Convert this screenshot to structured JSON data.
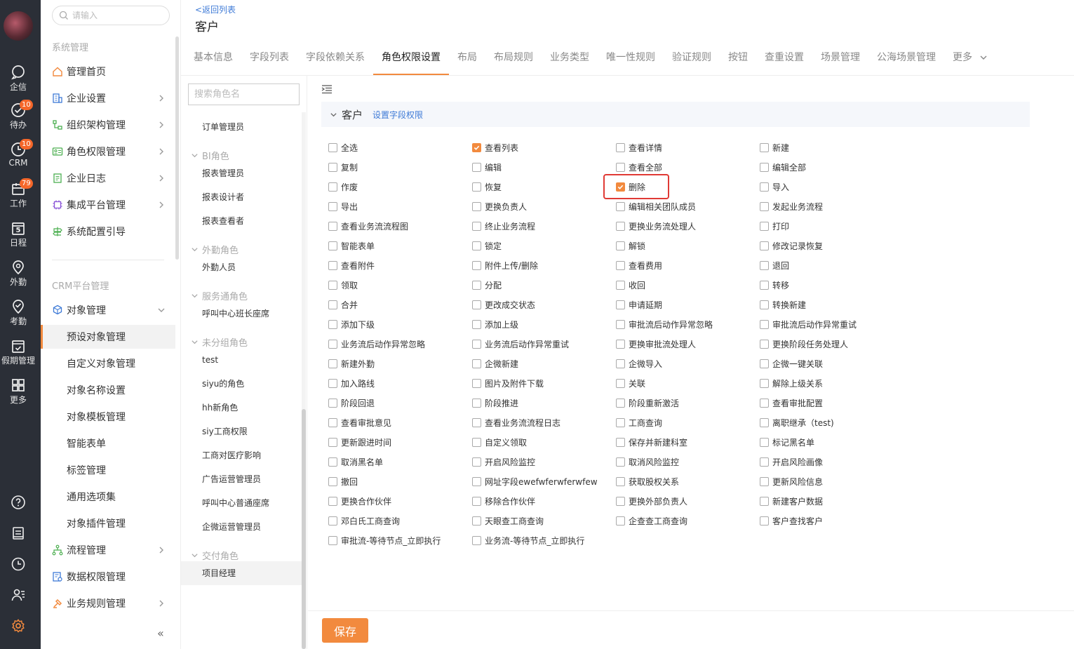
{
  "rail": {
    "items": [
      {
        "label": "企信",
        "icon": "chat-icon",
        "badge": ""
      },
      {
        "label": "待办",
        "icon": "check-circle-icon",
        "badge": "10"
      },
      {
        "label": "CRM",
        "icon": "crm-clock-icon",
        "badge": "10"
      },
      {
        "label": "工作",
        "icon": "calendar-work-icon",
        "badge": "79"
      },
      {
        "label": "日程",
        "icon": "schedule-icon",
        "badge": "",
        "day": "5"
      },
      {
        "label": "外勤",
        "icon": "location-pin-icon",
        "badge": ""
      },
      {
        "label": "考勤",
        "icon": "attendance-icon",
        "badge": ""
      },
      {
        "label": "假期管理",
        "icon": "vacation-icon",
        "badge": ""
      },
      {
        "label": "更多",
        "icon": "grid-icon",
        "badge": ""
      }
    ],
    "bottom_icons": [
      "help-icon",
      "notepad-icon",
      "history-icon",
      "user-list-icon",
      "settings-icon"
    ],
    "accent_color": "#f28a3e"
  },
  "nav": {
    "search_placeholder": "请输入",
    "section_system": "系统管理",
    "system_items": [
      {
        "label": "管理首页",
        "icon": "home-icon"
      },
      {
        "label": "企业设置",
        "icon": "building-icon"
      },
      {
        "label": "组织架构管理",
        "icon": "org-tree-icon"
      },
      {
        "label": "角色权限管理",
        "icon": "id-card-icon"
      },
      {
        "label": "企业日志",
        "icon": "log-icon"
      },
      {
        "label": "集成平台管理",
        "icon": "integration-icon"
      },
      {
        "label": "系统配置引导",
        "icon": "guide-icon"
      }
    ],
    "section_crm": "CRM平台管理",
    "object_mgmt": "对象管理",
    "object_sub": [
      "预设对象管理",
      "自定义对象管理",
      "对象名称设置",
      "对象模板管理",
      "智能表单",
      "标签管理",
      "通用选项集",
      "对象插件管理"
    ],
    "crm_items": [
      {
        "label": "流程管理",
        "icon": "flow-icon"
      },
      {
        "label": "数据权限管理",
        "icon": "data-perm-icon"
      },
      {
        "label": "业务规则管理",
        "icon": "rules-icon"
      }
    ],
    "collapse": "«"
  },
  "header": {
    "back": "<返回列表",
    "title": "客户",
    "tabs": [
      "基本信息",
      "字段列表",
      "字段依赖关系",
      "角色权限设置",
      "布局",
      "布局规则",
      "业务类型",
      "唯一性规则",
      "验证规则",
      "按钮",
      "查重设置",
      "场景管理",
      "公海场景管理",
      "更多"
    ],
    "active_tab": 3
  },
  "roles": {
    "search_placeholder": "搜索角色名",
    "top_item": "订单管理员",
    "groups": [
      {
        "name": "BI角色",
        "items": [
          "报表管理员",
          "报表设计者",
          "报表查看者"
        ]
      },
      {
        "name": "外勤角色",
        "items": [
          "外勤人员"
        ]
      },
      {
        "name": "服务通角色",
        "items": [
          "呼叫中心班长座席"
        ]
      },
      {
        "name": "未分组角色",
        "items": [
          "test",
          "siyu的角色",
          "hh新角色",
          "siy工商权限",
          "工商对医疗影响",
          "广告运营管理员",
          "呼叫中心普通座席",
          "企微运营管理员"
        ]
      },
      {
        "name": "交付角色",
        "items": [
          "项目经理"
        ]
      }
    ],
    "active_role": "项目经理"
  },
  "main": {
    "object_name": "客户",
    "field_perm_link": "设置字段权限",
    "permissions": [
      [
        "全选",
        "查看列表",
        "查看详情",
        "新建"
      ],
      [
        "复制",
        "编辑",
        "查看全部",
        "编辑全部"
      ],
      [
        "作废",
        "恢复",
        "删除",
        "导入"
      ],
      [
        "导出",
        "更换负责人",
        "编辑相关团队成员",
        "发起业务流程"
      ],
      [
        "查看业务流流程图",
        "终止业务流程",
        "更换业务流处理人",
        "打印"
      ],
      [
        "智能表单",
        "锁定",
        "解锁",
        "修改记录恢复"
      ],
      [
        "查看附件",
        "附件上传/删除",
        "查看费用",
        "退回"
      ],
      [
        "领取",
        "分配",
        "收回",
        "转移"
      ],
      [
        "合并",
        "更改成交状态",
        "申请延期",
        "转换新建"
      ],
      [
        "添加下级",
        "添加上级",
        "审批流后动作异常忽略",
        "审批流后动作异常重试"
      ],
      [
        "业务流后动作异常忽略",
        "业务流后动作异常重试",
        "更换审批流处理人",
        "更换阶段任务处理人"
      ],
      [
        "新建外勤",
        "企微新建",
        "企微导入",
        "企微一键关联"
      ],
      [
        "加入路线",
        "图片及附件下载",
        "关联",
        "解除上级关系"
      ],
      [
        "阶段回退",
        "阶段推进",
        "阶段重新激活",
        "查看审批配置"
      ],
      [
        "查看审批意见",
        "查看业务流流程日志",
        "工商查询",
        "离职继承（test)"
      ],
      [
        "更新跟进时间",
        "自定义领取",
        "保存并新建科室",
        "标记黑名单"
      ],
      [
        "取消黑名单",
        "开启风险监控",
        "取消风险监控",
        "开启风险画像"
      ],
      [
        "撤回",
        "网址字段ewefwferwferwfew",
        "获取股权关系",
        "更新风险信息"
      ],
      [
        "更换合作伙伴",
        "移除合作伙伴",
        "更换外部负责人",
        "新建客户数据"
      ],
      [
        "邓白氏工商查询",
        "天眼查工商查询",
        "企查查工商查询",
        "客户查找客户"
      ],
      [
        "审批流-等待节点_立即执行",
        "业务流-等待节点_立即执行",
        "",
        ""
      ]
    ],
    "checked": [
      "查看列表",
      "删除"
    ],
    "highlighted": "删除",
    "save": "保存"
  }
}
